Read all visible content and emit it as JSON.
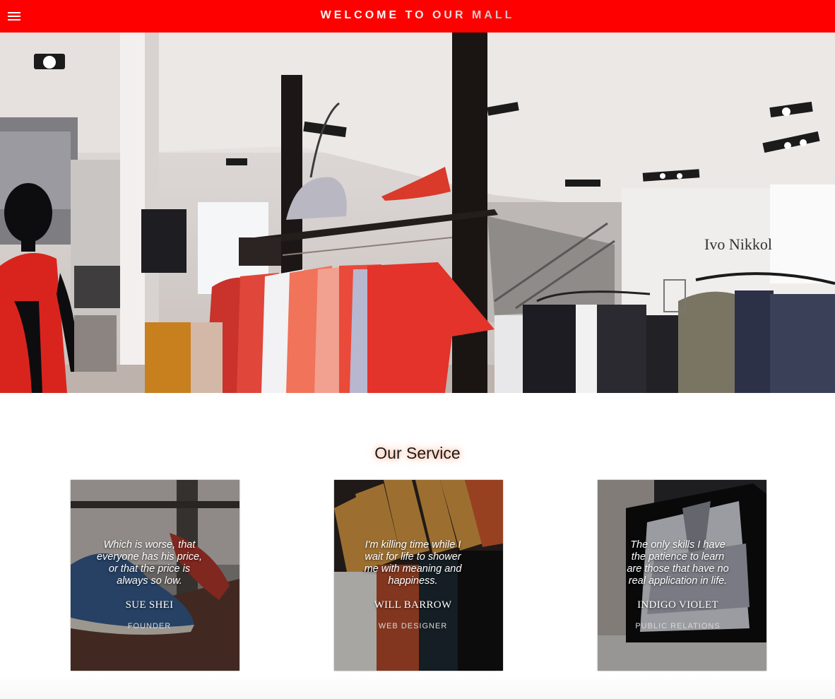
{
  "header": {
    "title": "WELCOME TO OUR MALL",
    "menu_icon": "hamburger-menu-icon",
    "background": "#ff0000"
  },
  "hero": {
    "sign_text": "Ivo Nikkol"
  },
  "service": {
    "heading": "Our Service",
    "cards": [
      {
        "quote": "Which is worse, that everyone has his price, or that the price is always so low.",
        "name": "SUE SHEI",
        "role": "FOUNDER"
      },
      {
        "quote": "I'm killing time while I wait for life to shower me with meaning and happiness.",
        "name": "WILL BARROW",
        "role": "WEB DESIGNER"
      },
      {
        "quote": "The only skills I have the patience to learn are those that have no real application in life.",
        "name": "INDIGO VIOLET",
        "role": "PUBLIC RELATIONS"
      }
    ]
  }
}
